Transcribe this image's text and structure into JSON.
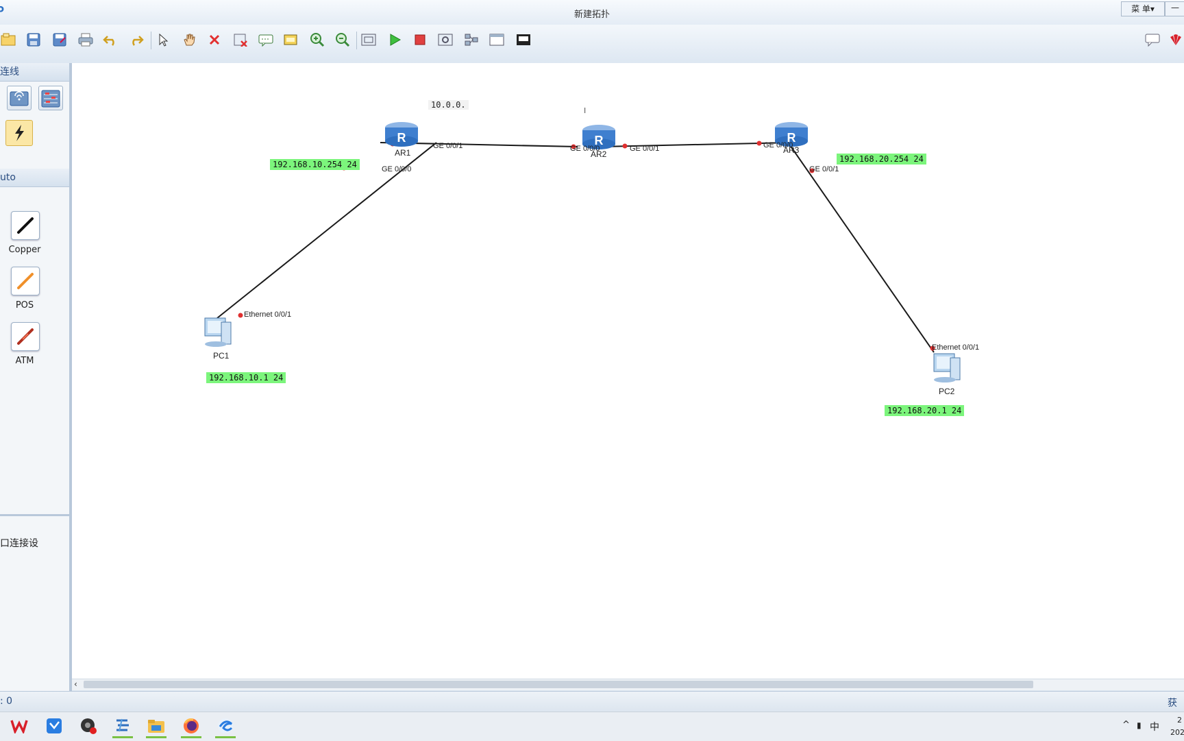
{
  "window": {
    "logo": "P",
    "title": "新建拓扑",
    "menu_label": "菜 单▾",
    "minimize": "—"
  },
  "toolbar": {
    "icons": [
      "new-topology-icon",
      "save-icon",
      "save-as-icon",
      "print-icon",
      "undo-icon",
      "redo-icon",
      "select-icon",
      "pan-hand-icon",
      "delete-icon",
      "delete-link-icon",
      "text-note-icon",
      "palette-icon",
      "zoom-in-icon",
      "zoom-out-icon",
      "fit-view-icon",
      "start-device-icon",
      "stop-device-icon",
      "capture-icon",
      "topology-icon",
      "window-icon",
      "screen-icon"
    ],
    "right_icons": [
      "chat-icon",
      "huawei-logo-icon"
    ]
  },
  "sidebar": {
    "section1_title": "连线",
    "section2_title": "uto",
    "cables": [
      {
        "name": "Copper",
        "color": "#111111"
      },
      {
        "name": "POS",
        "color": "#f0902a"
      },
      {
        "name": "ATM",
        "color": "#b03020"
      }
    ],
    "bottom_text": "口连接设"
  },
  "topology": {
    "note": "10.0.0.",
    "devices": {
      "ar1": "AR1",
      "ar2": "AR2",
      "ar3": "AR3",
      "pc1": "PC1",
      "pc2": "PC2"
    },
    "ports": {
      "ar1_ge001": "GE 0/0/1",
      "ar1_ge000": "GE 0/0/0",
      "ar2_ge000": "GE 0/0/0",
      "ar2_ge001": "GE 0/0/1",
      "ar3_ge000": "GE 0/0/0",
      "ar3_ge001": "GE 0/0/1",
      "pc1_eth": "Ethernet 0/0/1",
      "pc2_eth": "Ethernet 0/0/1"
    },
    "ip_labels": {
      "ar1": "192.168.10.254  24",
      "ar3": "192.168.20.254 24",
      "pc1": "192.168.10.1 24",
      "pc2": "192.168.20.1 24"
    },
    "link_color": "#1a1a1a",
    "port_dot_color": "#e03030",
    "ip_label_color": "#7cf57c"
  },
  "status": {
    "left": ": 0",
    "right": "获取"
  },
  "taskbar": {
    "apps": [
      "wps-icon",
      "mail-icon",
      "recorder-icon",
      "ensp-icon",
      "file-explorer-icon",
      "firefox-icon",
      "browser-icon"
    ],
    "tray": {
      "chevron": "^",
      "mic": "▮",
      "ime": "中",
      "time": "2",
      "date": "202"
    }
  }
}
